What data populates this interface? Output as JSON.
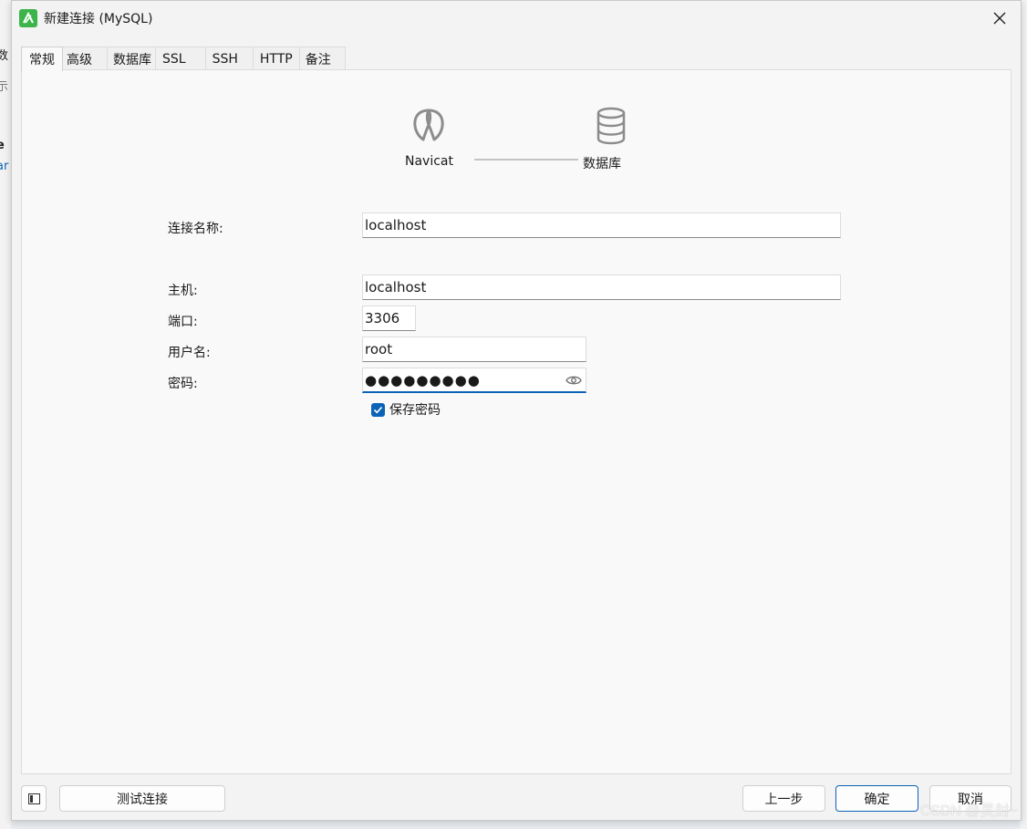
{
  "background": {
    "fragments": [
      ")",
      "数",
      "示",
      "e",
      "ar"
    ]
  },
  "window": {
    "title": "新建连接 (MySQL)",
    "close_label": "×"
  },
  "tabs": [
    {
      "label": "常规",
      "active": true
    },
    {
      "label": "高级"
    },
    {
      "label": "数据库"
    },
    {
      "label": "SSL"
    },
    {
      "label": "SSH"
    },
    {
      "label": "HTTP"
    },
    {
      "label": "备注"
    }
  ],
  "diagram": {
    "left_label": "Navicat",
    "right_label": "数据库",
    "left_icon": "navicat-logo-icon",
    "right_icon": "database-icon"
  },
  "form": {
    "connection_name": {
      "label": "连接名称:",
      "value": "localhost"
    },
    "host": {
      "label": "主机:",
      "value": "localhost"
    },
    "port": {
      "label": "端口:",
      "value": "3306"
    },
    "username": {
      "label": "用户名:",
      "value": "root"
    },
    "password": {
      "label": "密码:",
      "value": "●●●●●●●●●"
    },
    "save_password": {
      "label": "保存密码",
      "checked": true
    }
  },
  "footer": {
    "test_connection": "测试连接",
    "back": "上一步",
    "ok": "确定",
    "cancel": "取消"
  },
  "watermark": "CSDN @灵封~",
  "colors": {
    "accent": "#0b62b6",
    "app_icon": "#3bb54a"
  }
}
